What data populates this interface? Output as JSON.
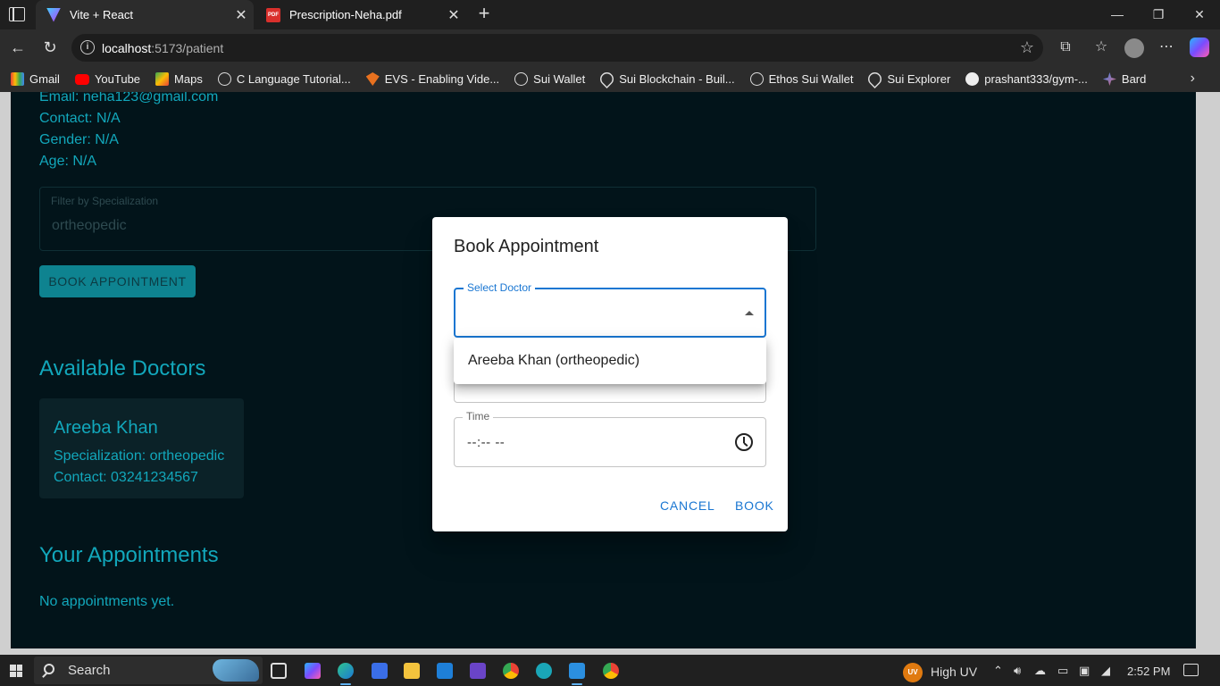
{
  "browser": {
    "tabs": [
      {
        "title": "Vite + React",
        "active": true
      },
      {
        "title": "Prescription-Neha.pdf",
        "active": false
      }
    ],
    "url_host": "localhost",
    "url_path": ":5173/patient",
    "bookmarks": [
      {
        "label": "Gmail",
        "icon": "gmail-icon"
      },
      {
        "label": "YouTube",
        "icon": "youtube-icon"
      },
      {
        "label": "Maps",
        "icon": "maps-icon"
      },
      {
        "label": "C Language Tutorial...",
        "icon": "globe-icon"
      },
      {
        "label": "EVS - Enabling Vide...",
        "icon": "evs-icon"
      },
      {
        "label": "Sui Wallet",
        "icon": "globe-icon"
      },
      {
        "label": "Sui Blockchain - Buil...",
        "icon": "sui-drop-icon"
      },
      {
        "label": "Ethos Sui Wallet",
        "icon": "globe-icon"
      },
      {
        "label": "Sui Explorer",
        "icon": "sui-drop-icon"
      },
      {
        "label": "prashant333/gym-...",
        "icon": "github-icon"
      },
      {
        "label": "Bard",
        "icon": "bard-icon"
      }
    ]
  },
  "patient": {
    "email": "Email: neha123@gmail.com",
    "contact": "Contact: N/A",
    "gender": "Gender: N/A",
    "age": "Age: N/A"
  },
  "filter": {
    "label": "Filter by Specialization",
    "value": "ortheopedic"
  },
  "book_button": "BOOK APPOINTMENT",
  "available_doctors": {
    "heading": "Available Doctors",
    "cards": [
      {
        "name": "Areeba Khan",
        "specialization": "Specialization: ortheopedic",
        "contact": "Contact: 03241234567"
      }
    ]
  },
  "appointments": {
    "heading": "Your Appointments",
    "empty_text": "No appointments yet."
  },
  "modal": {
    "title": "Book Appointment",
    "select_label": "Select Doctor",
    "dropdown_options": [
      "Areeba Khan (ortheopedic)"
    ],
    "time_label": "Time",
    "time_placeholder": "--:-- --",
    "cancel_label": "CANCEL",
    "book_label": "BOOK"
  },
  "taskbar": {
    "search_placeholder": "Search",
    "weather": "High UV",
    "weather_badge": "UV",
    "time": "2:52 PM"
  },
  "colors": {
    "page_bg": "#02141a",
    "accent_teal": "#12a7bb",
    "modal_primary": "#1976d2"
  }
}
